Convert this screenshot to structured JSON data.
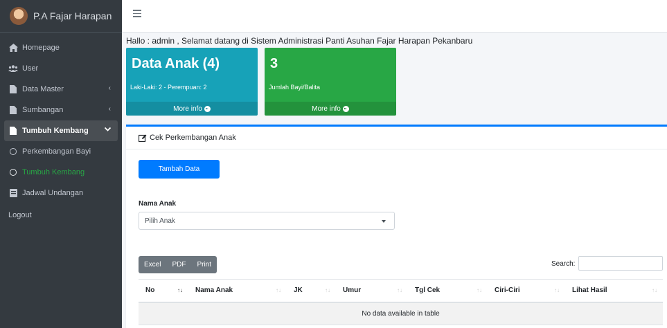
{
  "brand": {
    "title": "P.A Fajar Harapan"
  },
  "sidebar": {
    "items": [
      {
        "label": "Homepage",
        "icon": "home-icon"
      },
      {
        "label": "User",
        "icon": "users-icon"
      },
      {
        "label": "Data Master",
        "icon": "file-icon",
        "chevron": "‹"
      },
      {
        "label": "Sumbangan",
        "icon": "file-icon",
        "chevron": "‹"
      },
      {
        "label": "Tumbuh Kembang",
        "icon": "file-icon",
        "chevron": "⌄"
      },
      {
        "label": "Perkembangan Bayi",
        "icon": "circle-icon"
      },
      {
        "label": "Tumbuh Kembang",
        "icon": "circle-icon"
      },
      {
        "label": "Jadwal Undangan",
        "icon": "book-icon"
      },
      {
        "label": "Logout"
      }
    ]
  },
  "header": {
    "welcome": "Hallo : admin , Selamat datang di Sistem Administrasi Panti Asuhan Fajar Harapan Pekanbaru"
  },
  "boxes": [
    {
      "number": "Data Anak (4)",
      "label": "Laki-Laki: 2 - Perempuan: 2",
      "footer": "More info",
      "color": "#17a2b8"
    },
    {
      "number": "3",
      "label": "Jumlah Bayi/Balita",
      "footer": "More info",
      "color": "#28a745"
    }
  ],
  "card": {
    "title": "Cek Perkembangan Anak",
    "add_button": "Tambah Data",
    "field_label": "Nama Anak",
    "select_value": "Pilih Anak",
    "exports": [
      "Excel",
      "PDF",
      "Print"
    ],
    "search_label": "Search:",
    "columns": [
      "No",
      "Nama Anak",
      "JK",
      "Umur",
      "Tgl Cek",
      "Ciri-Ciri",
      "Lihat Hasil"
    ],
    "empty_text": "No data available in table"
  },
  "colors": {
    "primary": "#007bff",
    "sidebar": "#343a40",
    "active_link": "#28a745"
  }
}
